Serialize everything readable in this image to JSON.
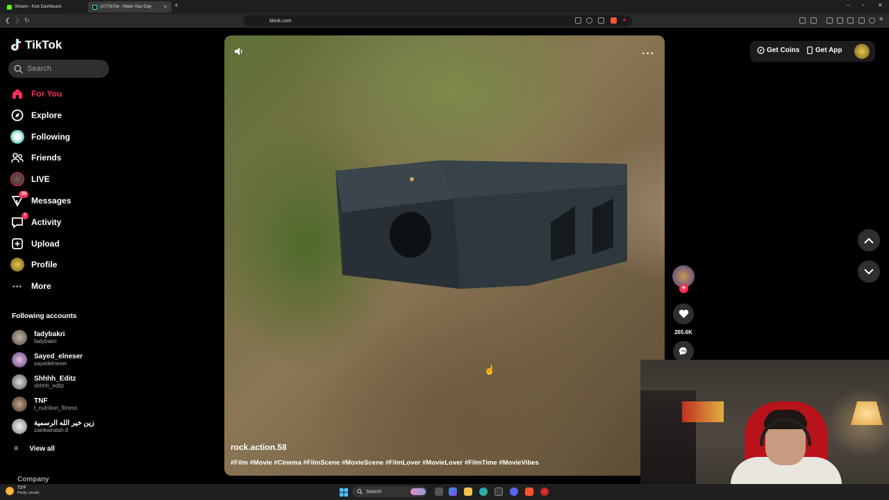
{
  "browser": {
    "tabs": [
      {
        "title": "Stream - Kick Dashboard",
        "active": false
      },
      {
        "title": "(37)TikTok - Make Your Day",
        "active": true
      }
    ],
    "new_tab": "+",
    "url": "tiktok.com",
    "window_controls": {
      "minimize": "–",
      "maximize": "▫",
      "close": "✕"
    }
  },
  "tiktok": {
    "logo_text": "TikTok",
    "search_placeholder": "Search",
    "nav": [
      {
        "label": "For You",
        "icon": "home-icon",
        "active": true
      },
      {
        "label": "Explore",
        "icon": "compass-icon"
      },
      {
        "label": "Following",
        "icon": "following-avatar-icon"
      },
      {
        "label": "Friends",
        "icon": "friends-icon"
      },
      {
        "label": "LIVE",
        "icon": "live-icon"
      },
      {
        "label": "Messages",
        "icon": "messages-icon",
        "badge": "30"
      },
      {
        "label": "Activity",
        "icon": "activity-icon",
        "badge": "7"
      },
      {
        "label": "Upload",
        "icon": "upload-icon"
      },
      {
        "label": "Profile",
        "icon": "profile-icon"
      },
      {
        "label": "More",
        "icon": "more-icon"
      }
    ],
    "following_title": "Following accounts",
    "accounts": [
      {
        "name": "fadybakri",
        "handle": "fadybakri"
      },
      {
        "name": "Sayed_elneser",
        "handle": "sayedelneser"
      },
      {
        "name": "Shhhh_Editz",
        "handle": "shhhh_editz"
      },
      {
        "name": "TNF",
        "handle": "t_nutrition_fitness"
      },
      {
        "name": "زين خير الله الرسمية",
        "handle": "zainkairalah.8"
      }
    ],
    "view_all": "View all",
    "company": "Company",
    "top_right": {
      "get_coins": "Get Coins",
      "get_app": "Get App"
    },
    "video": {
      "author": "rock.action.58",
      "hashtags": "#Film #Movie #Cinema #FilmScene #MovieScene #FilmLover #MovieLover #FilmTime #MovieVibes",
      "more": "···",
      "likes": "265.6K",
      "follow_plus": "+"
    }
  },
  "taskbar": {
    "weather_temp": "73°F",
    "weather_desc": "Partly cloudy",
    "search_label": "Search"
  },
  "colors": {
    "accent": "#fe2c55",
    "background": "#000000",
    "surface": "#2f2f2f"
  }
}
